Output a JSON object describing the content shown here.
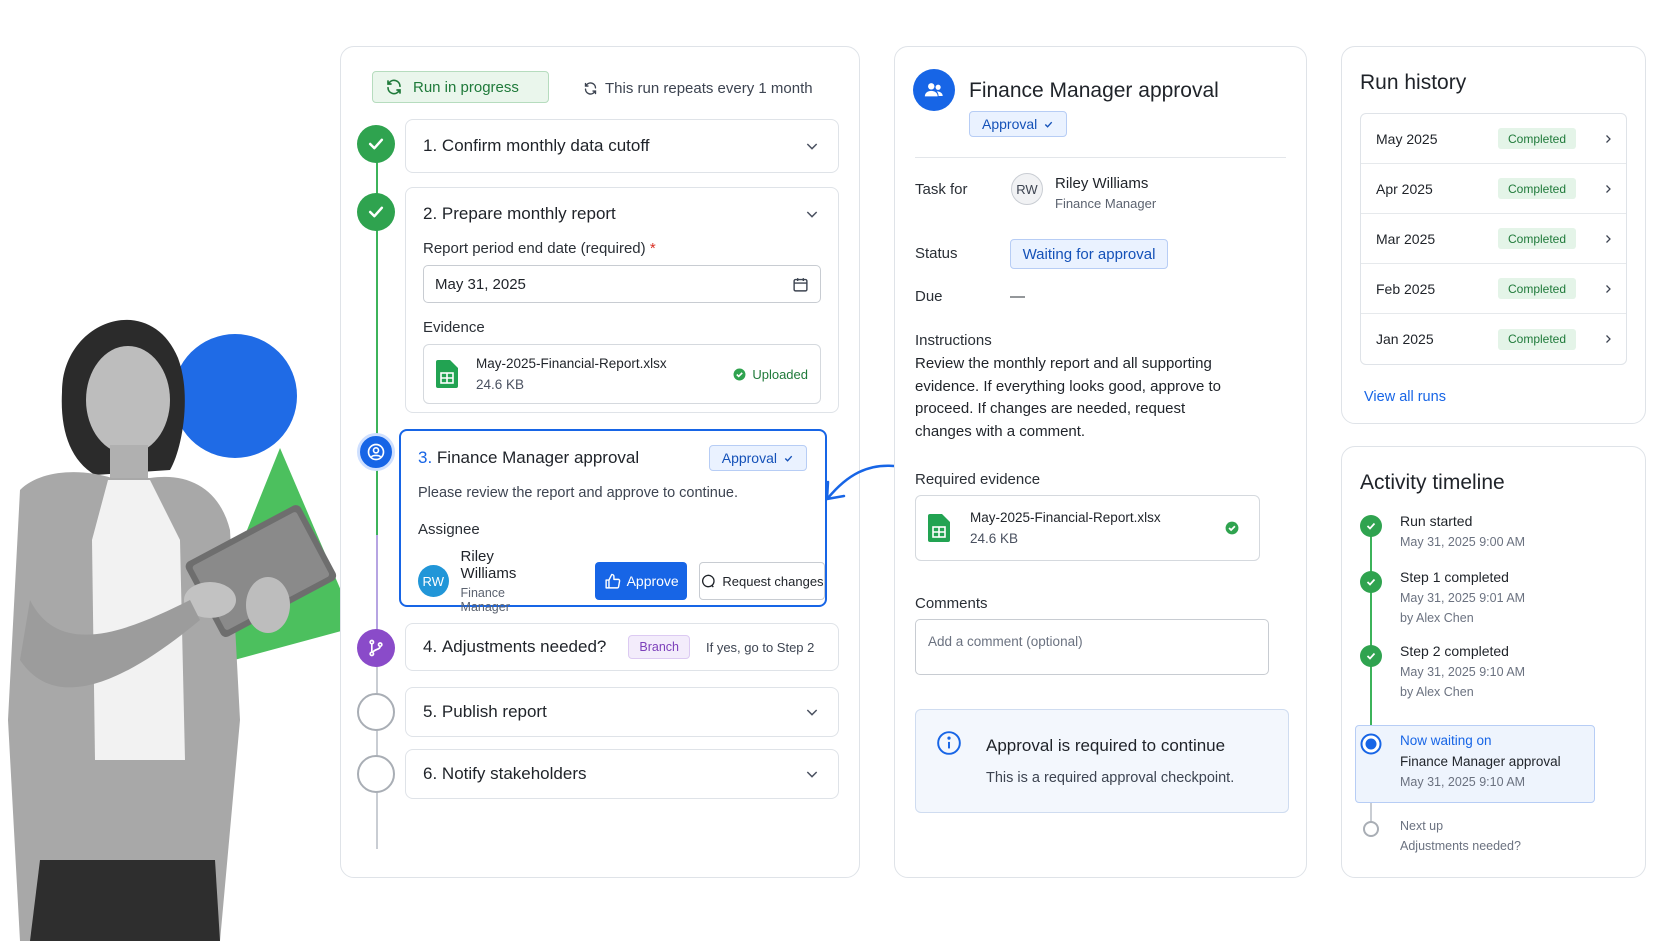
{
  "workflow": {
    "run_status": "Run in progress",
    "repeat_note": "This run repeats every 1 month",
    "steps": [
      {
        "num": "1.",
        "title": "Confirm monthly data cutoff"
      },
      {
        "num": "2.",
        "title": "Prepare monthly report",
        "date_label": "Report period end date (required)",
        "required_mark": "*",
        "date_value": "May 31, 2025",
        "evidence_label": "Evidence",
        "file_name": "May-2025-Financial-Report.xlsx",
        "file_size": "24.6 KB",
        "upload_status": "Uploaded"
      },
      {
        "num": "3.",
        "title": "Finance Manager approval",
        "type_pill": "Approval",
        "description": "Please review the report and approve to continue.",
        "assignee_label": "Assignee",
        "assignee_initials": "RW",
        "assignee_name": "Riley Williams",
        "assignee_role": "Finance Manager",
        "approve_label": "Approve",
        "request_changes_label": "Request changes"
      },
      {
        "num": "4.",
        "title": "Adjustments needed?",
        "branch_pill": "Branch",
        "branch_note": "If yes, go to Step 2"
      },
      {
        "num": "5.",
        "title": "Publish report"
      },
      {
        "num": "6.",
        "title": "Notify stakeholders"
      }
    ]
  },
  "details": {
    "title": "Finance Manager approval",
    "type_pill": "Approval",
    "task_for_label": "Task for",
    "assignee_initials": "RW",
    "assignee_name": "Riley Williams",
    "assignee_role": "Finance Manager",
    "status_label": "Status",
    "status_value": "Waiting for approval",
    "due_label": "Due",
    "due_value": "—",
    "instructions_label": "Instructions",
    "instructions_text": "Review the monthly report and all supporting evidence. If everything looks good, approve to proceed. If changes are needed, request changes with a comment.",
    "required_evidence_label": "Required evidence",
    "file_name": "May-2025-Financial-Report.xlsx",
    "file_size": "24.6 KB",
    "comments_label": "Comments",
    "comment_placeholder": "Add a comment (optional)",
    "info_title": "Approval is required to continue",
    "info_sub": "This is a required approval checkpoint."
  },
  "history": {
    "title": "Run history",
    "rows": [
      {
        "month": "May 2025",
        "status": "Completed"
      },
      {
        "month": "Apr 2025",
        "status": "Completed"
      },
      {
        "month": "Mar 2025",
        "status": "Completed"
      },
      {
        "month": "Feb 2025",
        "status": "Completed"
      },
      {
        "month": "Jan 2025",
        "status": "Completed"
      }
    ],
    "view_all": "View all runs"
  },
  "activity": {
    "title": "Activity timeline",
    "items": [
      {
        "title": "Run started",
        "time": "May 31, 2025 9:00 AM"
      },
      {
        "title": "Step 1 completed",
        "time": "May 31, 2025 9:01 AM",
        "by": "by Alex Chen"
      },
      {
        "title": "Step 2 completed",
        "time": "May 31, 2025 9:10 AM",
        "by": "by Alex Chen"
      }
    ],
    "now_label": "Now waiting on",
    "now_title": "Finance Manager approval",
    "now_time": "May 31, 2025 9:10 AM",
    "next_label": "Next up",
    "next_title": "Adjustments needed?"
  },
  "colors": {
    "primary": "#1765e6",
    "success": "#2fa34f",
    "branch": "#8a4bc9"
  },
  "icons": [
    "refresh-icon",
    "check-icon",
    "chevron-down-icon",
    "calendar-icon",
    "spreadsheet-icon",
    "user-circle-icon",
    "branch-icon",
    "thumbs-up-icon",
    "comment-icon",
    "users-icon",
    "info-icon",
    "chevron-right-icon"
  ]
}
